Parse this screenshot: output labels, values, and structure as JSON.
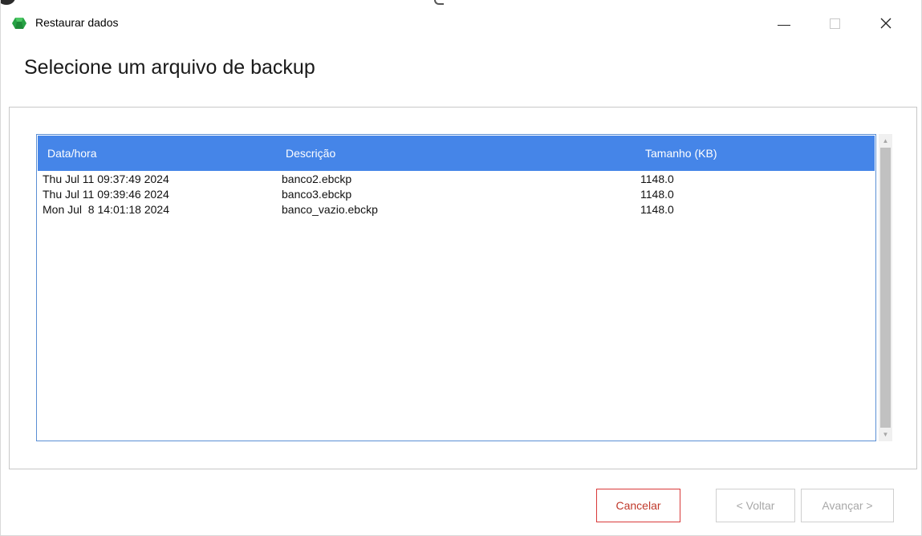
{
  "window": {
    "title": "Restaurar dados",
    "minimize_icon": "minimize-icon",
    "maximize_icon": "maximize-icon",
    "close_icon": "close-icon",
    "close_glyph": "✕"
  },
  "header": {
    "title": "Selecione um arquivo de backup"
  },
  "table": {
    "columns": [
      "Data/hora",
      "Descrição",
      "Tamanho (KB)"
    ],
    "rows": [
      [
        "Thu Jul 11 09:37:49 2024",
        "banco2.ebckp",
        "1148.0"
      ],
      [
        "Thu Jul 11 09:39:46 2024",
        "banco3.ebckp",
        "1148.0"
      ],
      [
        "Mon Jul  8 14:01:18 2024",
        "banco_vazio.ebckp",
        "1148.0"
      ]
    ],
    "header_color": "#4585e8",
    "border_color": "#5b8fd4"
  },
  "scrollbar": {
    "up_arrow": "▲",
    "down_arrow": "▼"
  },
  "buttons": {
    "cancel": "Cancelar",
    "back": "< Voltar",
    "next": "Avançar >",
    "cancel_color": "#d93a3a"
  },
  "icons": {
    "app": "green-gem-icon"
  }
}
